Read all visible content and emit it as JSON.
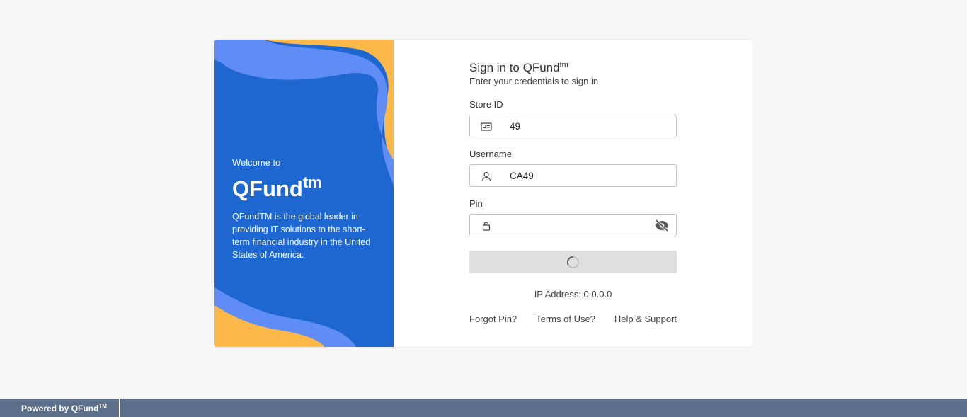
{
  "welcome_panel": {
    "greeting": "Welcome to",
    "brand": "QFund",
    "brand_sup": "tm",
    "description": "QFundTM is the global leader in providing IT solutions to the short-term financial industry in the United States of America."
  },
  "form": {
    "title": "Sign in to QFund",
    "title_sup": "tm",
    "subtitle": "Enter your credentials to sign in",
    "store_id": {
      "label": "Store ID",
      "value": "49",
      "icon": "id-card-icon"
    },
    "username": {
      "label": "Username",
      "value": "CA49",
      "icon": "user-icon"
    },
    "pin": {
      "label": "Pin",
      "value": "",
      "icon": "lock-icon",
      "toggle_icon": "eye-off-icon"
    },
    "submit": {
      "state": "loading",
      "icon": "spinner-icon"
    },
    "ip_address": "IP Address: 0.0.0.0",
    "links": [
      "Forgot Pin?",
      "Terms of Use?",
      "Help & Support"
    ]
  },
  "footer": {
    "powered_by": "Powered by QFund",
    "powered_sup": "TM"
  },
  "colors": {
    "panel_blue": "#1e67d0",
    "wave_light_blue": "#5f8cf5",
    "wave_yellow": "#fdb84a",
    "footer": "#5b6e8a",
    "button_disabled": "#e0e0e0"
  }
}
